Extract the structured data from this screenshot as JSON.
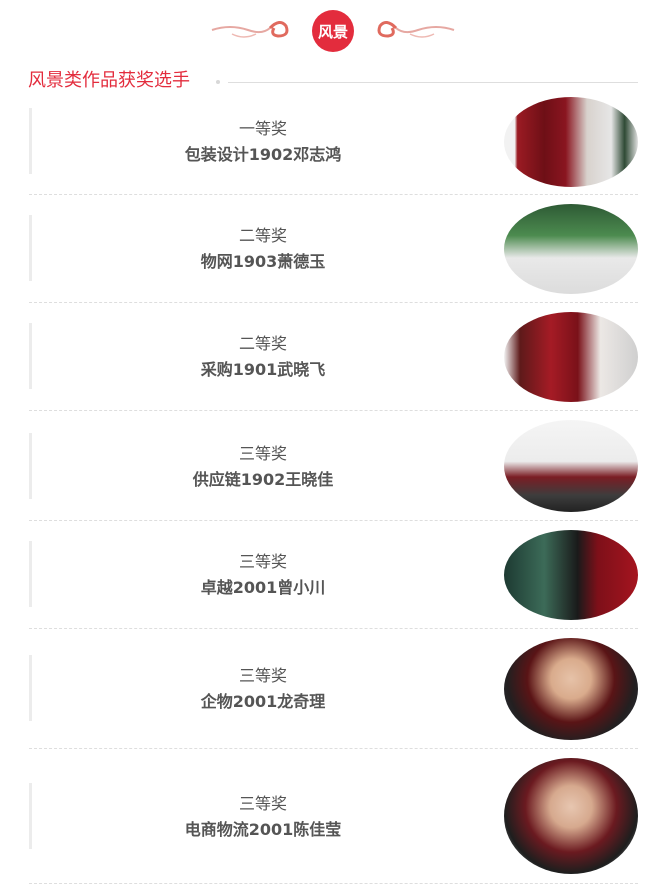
{
  "header": {
    "badge": "风景"
  },
  "section": {
    "title": "风景类作品获奖选手"
  },
  "entries": [
    {
      "award": "一等奖",
      "name": "包装设计1902邓志鸿",
      "photo": "speaker-photo"
    },
    {
      "award": "二等奖",
      "name": "物网1903萧德玉",
      "photo": "speaker-photo"
    },
    {
      "award": "二等奖",
      "name": "采购1901武晓飞",
      "photo": "speaker-photo"
    },
    {
      "award": "三等奖",
      "name": "供应链1902王晓佳",
      "photo": "classroom-photo"
    },
    {
      "award": "三等奖",
      "name": "卓越2001曾小川",
      "photo": "speaker-photo"
    },
    {
      "award": "三等奖",
      "name": "企物2001龙奇理",
      "photo": "portrait-photo"
    },
    {
      "award": "三等奖",
      "name": "电商物流2001陈佳莹",
      "photo": "portrait-photo"
    }
  ],
  "colors": {
    "accent": "#e32c3d",
    "text": "#555555",
    "divider": "#dedede"
  }
}
